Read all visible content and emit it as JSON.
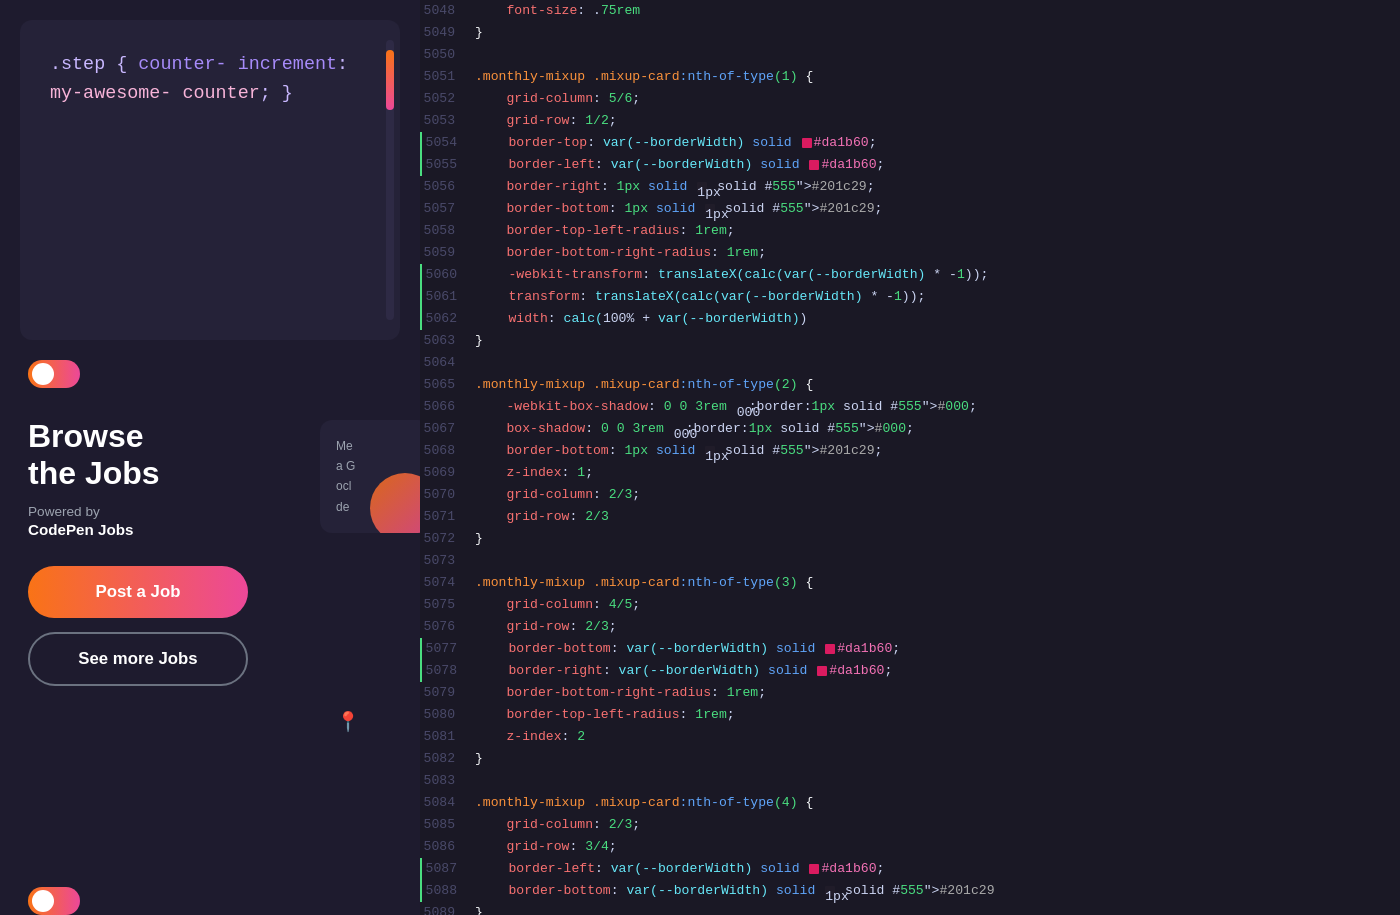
{
  "left": {
    "code_snippet": ".step { counter-increment: my-awesome-counter; }",
    "browse_title_line1": "Browse",
    "browse_title_line2": "the Jobs",
    "powered_by": "Powered by",
    "codepen_jobs": "CodePen Jobs",
    "post_button": "Post a Job",
    "more_button": "See more Jobs",
    "card_text": "Me\na G\nocl\nde"
  },
  "editor": {
    "lines": [
      {
        "num": "5048",
        "content": "    font-size: .75rem"
      },
      {
        "num": "5049",
        "content": "}"
      },
      {
        "num": "5050",
        "content": ""
      },
      {
        "num": "5051",
        "content": ".monthly-mixup .mixup-card:nth-of-type(1) {"
      },
      {
        "num": "5052",
        "content": "    grid-column: 5/6;"
      },
      {
        "num": "5053",
        "content": "    grid-row: 1/2;"
      },
      {
        "num": "5054",
        "content": "    border-top: var(--borderWidth) solid #da1b60;",
        "green_bar": true
      },
      {
        "num": "5055",
        "content": "    border-left: var(--borderWidth) solid #da1b60;",
        "green_bar": true
      },
      {
        "num": "5056",
        "content": "    border-right: 1px solid #201c29;"
      },
      {
        "num": "5057",
        "content": "    border-bottom: 1px solid #201c29;"
      },
      {
        "num": "5058",
        "content": "    border-top-left-radius: 1rem;"
      },
      {
        "num": "5059",
        "content": "    border-bottom-right-radius: 1rem;"
      },
      {
        "num": "5060",
        "content": "    -webkit-transform: translateX(calc(var(--borderWidth) * -1));",
        "green_bar": true
      },
      {
        "num": "5061",
        "content": "    transform: translateX(calc(var(--borderWidth) * -1));",
        "green_bar": true
      },
      {
        "num": "5062",
        "content": "    width: calc(100% + var(--borderWidth))",
        "green_bar": true
      },
      {
        "num": "5063",
        "content": "}"
      },
      {
        "num": "5064",
        "content": ""
      },
      {
        "num": "5065",
        "content": ".monthly-mixup .mixup-card:nth-of-type(2) {"
      },
      {
        "num": "5066",
        "content": "    -webkit-box-shadow: 0 0 3rem #000;"
      },
      {
        "num": "5067",
        "content": "    box-shadow: 0 0 3rem #000;"
      },
      {
        "num": "5068",
        "content": "    border-bottom: 1px solid #201c29;"
      },
      {
        "num": "5069",
        "content": "    z-index: 1;"
      },
      {
        "num": "5070",
        "content": "    grid-column: 2/3;"
      },
      {
        "num": "5071",
        "content": "    grid-row: 2/3"
      },
      {
        "num": "5072",
        "content": "}"
      },
      {
        "num": "5073",
        "content": ""
      },
      {
        "num": "5074",
        "content": ".monthly-mixup .mixup-card:nth-of-type(3) {"
      },
      {
        "num": "5075",
        "content": "    grid-column: 4/5;"
      },
      {
        "num": "5076",
        "content": "    grid-row: 2/3;"
      },
      {
        "num": "5077",
        "content": "    border-bottom: var(--borderWidth) solid #da1b60;",
        "green_bar": true
      },
      {
        "num": "5078",
        "content": "    border-right: var(--borderWidth) solid #da1b60;",
        "green_bar": true
      },
      {
        "num": "5079",
        "content": "    border-bottom-right-radius: 1rem;"
      },
      {
        "num": "5080",
        "content": "    border-top-left-radius: 1rem;"
      },
      {
        "num": "5081",
        "content": "    z-index: 2"
      },
      {
        "num": "5082",
        "content": "}"
      },
      {
        "num": "5083",
        "content": ""
      },
      {
        "num": "5084",
        "content": ".monthly-mixup .mixup-card:nth-of-type(4) {"
      },
      {
        "num": "5085",
        "content": "    grid-column: 2/3;"
      },
      {
        "num": "5086",
        "content": "    grid-row: 3/4;"
      },
      {
        "num": "5087",
        "content": "    border-left: var(--borderWidth) solid #da1b60;",
        "green_bar": true
      },
      {
        "num": "5088",
        "content": "    border-bottom: var(--borderWidth) solid #201c29",
        "green_bar": true
      },
      {
        "num": "5089",
        "content": "}"
      }
    ]
  }
}
